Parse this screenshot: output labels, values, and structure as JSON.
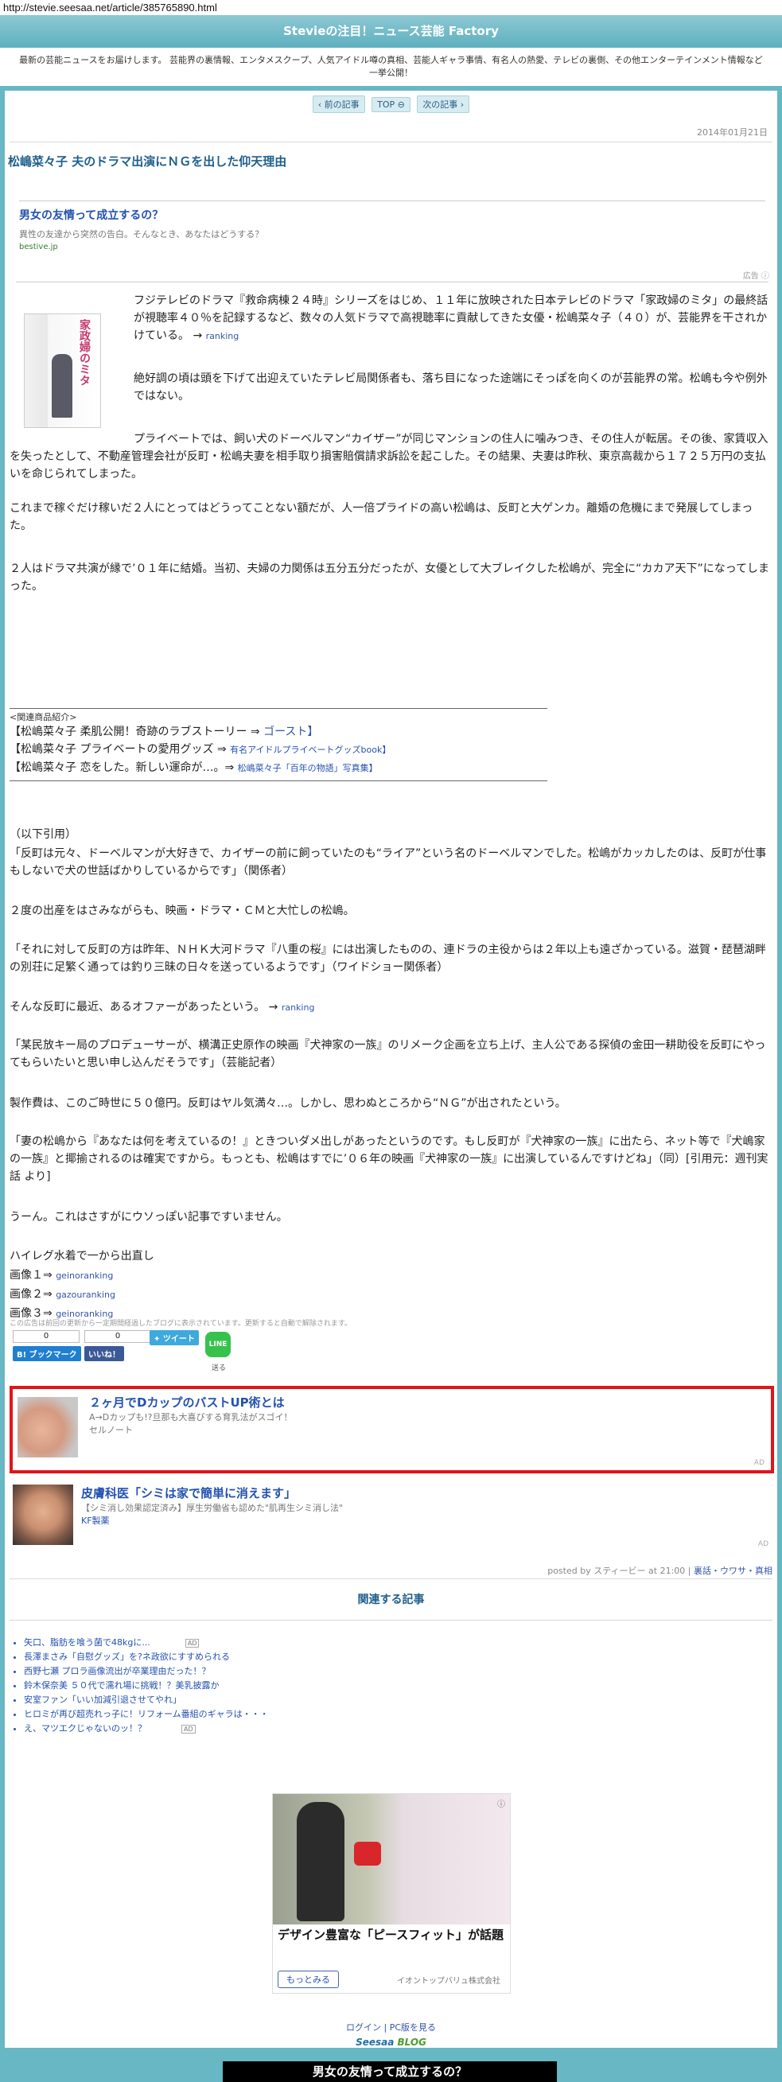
{
  "browser": {
    "url": "http://stevie.seesaa.net/article/385765890.html"
  },
  "site": {
    "title": "Stevieの注目！ニュース芸能 Factory",
    "description": "最新の芸能ニュースをお届けします。 芸能界の裏情報、エンタメスクープ、人気アイドル噂の真相、芸能人ギャラ事情、有名人の熱愛、テレビの裏側、その他エンターテインメント情報など一挙公開！"
  },
  "nav": {
    "prev": "前の記事",
    "top": "TOP",
    "next": "次の記事"
  },
  "article": {
    "date": "2014年01月21日",
    "title": "松嶋菜々子 夫のドラマ出演にＮＧを出した仰天理由",
    "dvd_title": "家政婦のミタ",
    "paragraphs": {
      "p1": "フジテレビのドラマ『救命病棟２４時』シリーズをはじめ、１１年に放映された日本テレビのドラマ「家政婦のミタ」の最終話が視聴率４０％を記録するなど、数々の人気ドラマで高視聴率に貢献してきた女優・松嶋菜々子（４０）が、芸能界を干されかけている。",
      "p1_arrow": "→",
      "p1_link": "ranking",
      "p2": "絶好調の頃は頭を下げて出迎えていたテレビ局関係者も、落ち目になった途端にそっぽを向くのが芸能界の常。松嶋も今や例外ではない。",
      "p3": "プライベートでは、飼い犬のドーベルマン“カイザー”が同じマンションの住人に噛みつき、その住人が転居。その後、家賃収入を失ったとして、不動産管理会社が反町・松嶋夫妻を相手取り損害賠償請求訴訟を起こした。その結果、夫妻は昨秋、東京高裁から１７２５万円の支払いを命じられてしまった。",
      "p4": "これまで稼ぐだけ稼いだ２人にとってはどうってことない額だが、人一倍プライドの高い松嶋は、反町と大ゲンカ。離婚の危機にまで発展してしまった。",
      "p5": "２人はドラマ共演が縁で’０１年に結婚。当初、夫婦の力関係は五分五分だったが、女優として大ブレイクした松嶋が、完全に“カカア天下”になってしまった。",
      "quote_intro": "（以下引用）",
      "q1": "「反町は元々、ドーベルマンが大好きで、カイザーの前に飼っていたのも“ライア”という名のドーベルマンでした。松嶋がカッカしたのは、反町が仕事もしないで犬の世話ばかりしているからです」（関係者）",
      "q2": "２度の出産をはさみながらも、映画・ドラマ・ＣＭと大忙しの松嶋。",
      "q3": "「それに対して反町の方は昨年、ＮＨＫ大河ドラマ『八重の桜』には出演したものの、連ドラの主役からは２年以上も遠ざかっている。滋賀・琵琶湖畔の別荘に足繁く通っては釣り三昧の日々を送っているようです」（ワイドショー関係者）",
      "q4": "そんな反町に最近、あるオファーがあったという。",
      "q4_arrow": "→",
      "q4_link": "ranking",
      "q5": "「某民放キー局のプロデューサーが、横溝正史原作の映画『犬神家の一族』のリメーク企画を立ち上げ、主人公である探偵の金田一耕助役を反町にやってもらいたいと思い申し込んだそうです」（芸能記者）",
      "q6": "製作費は、このご時世に５０億円。反町はヤル気満々…。しかし、思わぬところから“ＮＧ”が出されたという。",
      "q7": "「妻の松嶋から『あなたは何を考えているの！』ときついダメ出しがあったというのです。もし反町が『犬神家の一族』に出たら、ネット等で『犬嶋家の一族』と揶揄されるのは確実ですから。もっとも、松嶋はすでに’０６年の映画『犬神家の一族』に出演しているんですけどね」（同）[引用元：週刊実話 より]",
      "q8": "うーん。これはさすがにウソっぽい記事ですいません。",
      "q9": "ハイレグ水着で一から出直し"
    },
    "related_box": {
      "caption": "<関連商品紹介>",
      "items": [
        {
          "text": "【松嶋菜々子 柔肌公開！奇跡のラブストーリー ⇒",
          "link": "ゴースト】",
          "small": false
        },
        {
          "text": "【松嶋菜々子 プライベートの愛用グッズ ⇒",
          "link": "有名アイドルプライベートグッズbook】",
          "small": true
        },
        {
          "text": "【松嶋菜々子 恋をした。新しい運命が…。⇒",
          "link": "松嶋菜々子「百年の物語」写真集】",
          "small": true
        }
      ]
    },
    "images": [
      {
        "label": "画像１⇒",
        "link": "geinoranking"
      },
      {
        "label": "画像２⇒",
        "link": "gazouranking"
      },
      {
        "label": "画像３⇒",
        "link": "geinoranking"
      }
    ]
  },
  "ad_top": {
    "headline": "男女の友情って成立するの？",
    "desc": "異性の友達から突然の告白。そんなとき、あなたはどうする？",
    "source": "bestive.jp",
    "label": "広告"
  },
  "ad_notice": "この広告は前回の更新から一定期間経過したブログに表示されています。更新すると自動で解除されます。",
  "share": {
    "hatena_count": "0",
    "hatena_label": "B! ブックマーク",
    "fb_count": "0",
    "fb_label": "いいね！",
    "tweet_label": "ツイート",
    "line_label": "LINE",
    "line_send": "送る"
  },
  "ad_bust": {
    "headline": "２ヶ月でDカップのバストUP術とは",
    "desc": "A→Dカップも!?旦那も大喜びする育乳法がスゴイ！",
    "source": "セルノート",
    "tag": "AD"
  },
  "ad_skin": {
    "headline": "皮膚科医「シミは家で簡単に消えます」",
    "desc": "【シミ消し効果認定済み】厚生労働省も認めた\"肌再生シミ消し法\"",
    "source": "KF製薬",
    "tag": "AD"
  },
  "posted": {
    "prefix": "posted by スティービー at 21:00 |",
    "category": "裏話・ウワサ・真相"
  },
  "related": {
    "title": "関連する記事",
    "items": [
      {
        "text": "矢口、脂肪を喰う菌で48kgに...",
        "ad": true
      },
      {
        "text": "長澤まさみ「自慰グッズ」を?ネ政欲にすすめられる",
        "ad": false
      },
      {
        "text": "西野七瀬 プロラ画像流出が卒業理由だった！？",
        "ad": false
      },
      {
        "text": "鈴木保奈美 ５０代で濡れ場に挑戦！？美乳披露か",
        "ad": false
      },
      {
        "text": "安室ファン「いい加減引退させてやれ」",
        "ad": false
      },
      {
        "text": "ヒロミが再び超売れっ子に！リフォーム番組のギャラは・・・",
        "ad": false
      },
      {
        "text": "え、マツエクじゃないのッ！？",
        "ad": true
      }
    ],
    "ad_tag": "AD"
  },
  "big_ad": {
    "headline": "デザイン豊富な「ピースフィット」が話題",
    "button": "もっとみる",
    "sponsor": "イオントップバリュ株式会社"
  },
  "footer": {
    "login": "ログイン",
    "pc": "PC版を見る",
    "logo1": "Seesaa",
    "logo2": "BLOG"
  },
  "bottom_bar": "男女の友情って成立するの？"
}
